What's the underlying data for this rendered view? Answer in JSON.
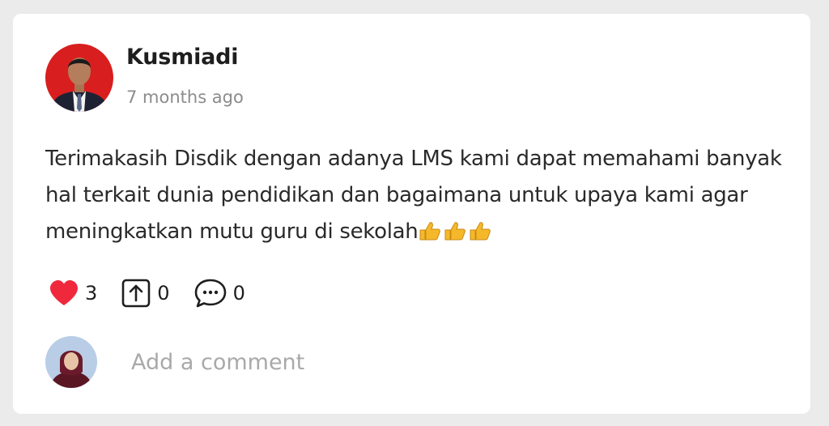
{
  "post": {
    "author": "Kusmiadi",
    "timestamp": "7 months ago",
    "text": "Terimakasih Disdik dengan adanya LMS kami dapat memahami banyak hal terkait dunia pendidikan dan bagaimana untuk upaya kami agar meningkatkan mutu guru di sekolah",
    "emoji": "👍👍👍"
  },
  "actions": {
    "likes": "3",
    "shares": "0",
    "comments": "0"
  },
  "comment": {
    "placeholder": "Add a comment"
  },
  "colors": {
    "heart": "#f0283c",
    "author_avatar_bg": "#d81e1e",
    "commenter_avatar_bg": "#b9cde6"
  },
  "icons": [
    "heart-icon",
    "share-icon",
    "comment-icon"
  ]
}
